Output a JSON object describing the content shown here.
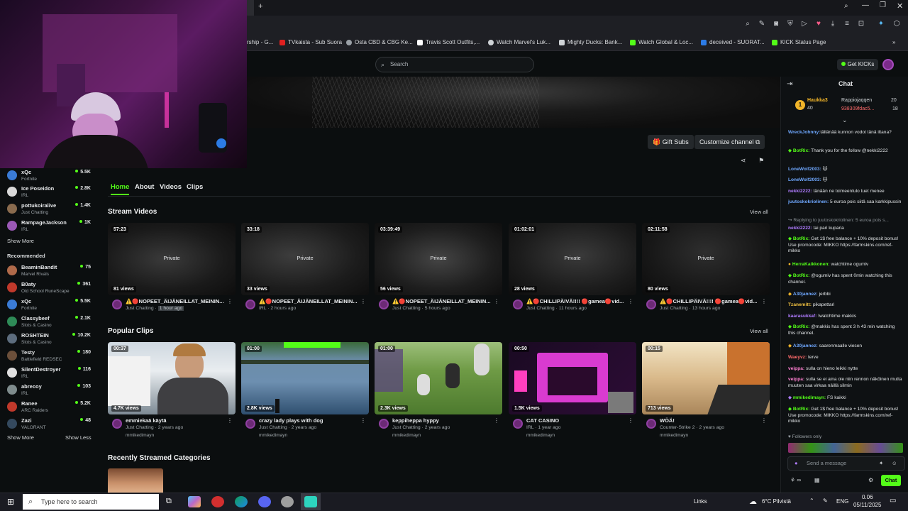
{
  "bookmarks": [
    {
      "label": "rship - G...",
      "color": "#5b8de0"
    },
    {
      "label": "TVkaista - Sub Suora",
      "color": "#e02020"
    },
    {
      "label": "Osta CBD & CBG Ke...",
      "color": "#9aa0a6"
    },
    {
      "label": "Travis Scott Outfits,...",
      "color": "#ffffff"
    },
    {
      "label": "Watch Marvel's Luk...",
      "color": "#cfd3d6"
    },
    {
      "label": "Mighty Ducks: Bank...",
      "color": "#cfd3d6"
    },
    {
      "label": "Watch Global & Loc...",
      "color": "#53fc18"
    },
    {
      "label": "deceived - SUORAT...",
      "color": "#2c7be5"
    },
    {
      "label": "KICK Status Page",
      "color": "#53fc18"
    }
  ],
  "header": {
    "search_placeholder": "Search",
    "get_kicks": "Get KICKs"
  },
  "channel": {
    "gift_subs": "Gift Subs",
    "customize": "Customize channel",
    "tabs": [
      "Home",
      "About",
      "Videos",
      "Clips"
    ]
  },
  "sidebar": {
    "following": [
      {
        "name": "xQc",
        "game": "Fortnite",
        "count": "5.5K",
        "color": "#3a7bd5"
      },
      {
        "name": "Ice Poseidon",
        "game": "IRL",
        "count": "2.8K",
        "color": "#d9d9d9"
      },
      {
        "name": "pottukoiralive",
        "game": "Just Chatting",
        "count": "1.4K",
        "color": "#8a6b4e"
      },
      {
        "name": "RampageJackson",
        "game": "IRL",
        "count": "1K",
        "color": "#9b59b6"
      }
    ],
    "show_more": "Show More",
    "recommended_title": "Recommended",
    "recommended": [
      {
        "name": "BeaminBandit",
        "game": "Marvel Rivals",
        "count": "75",
        "color": "#b06a4a"
      },
      {
        "name": "B0aty",
        "game": "Old School RuneScape",
        "count": "361",
        "color": "#c0392b"
      },
      {
        "name": "xQc",
        "game": "Fortnite",
        "count": "5.5K",
        "color": "#3a7bd5"
      },
      {
        "name": "Classybeef",
        "game": "Slots & Casino",
        "count": "2.1K",
        "color": "#2e8b57"
      },
      {
        "name": "ROSHTEIN",
        "game": "Slots & Casino",
        "count": "10.2K",
        "color": "#5d6d7e"
      },
      {
        "name": "Testy",
        "game": "Battlefield REDSEC",
        "count": "180",
        "color": "#6b4f3a"
      },
      {
        "name": "SilentDestroyer",
        "game": "IRL",
        "count": "116",
        "color": "#e0e0e0"
      },
      {
        "name": "abrecoy",
        "game": "IRL",
        "count": "103",
        "color": "#7f8c8d"
      },
      {
        "name": "Ranee",
        "game": "ARC Raiders",
        "count": "5.2K",
        "color": "#c0392b"
      },
      {
        "name": "Zazi",
        "game": "VALORANT",
        "count": "48",
        "color": "#34495e"
      }
    ],
    "show_more_2": "Show More",
    "show_less": "Show Less"
  },
  "stream_videos": {
    "title": "Stream Videos",
    "view_all": "View all",
    "items": [
      {
        "duration": "57:23",
        "views": "81 views",
        "title": "⚠️🔴NOPEET_ÄIJÄNEILLAT_MEININ...",
        "meta": "Just Chatting",
        "meta_time": "1 hour ago",
        "private": "Private"
      },
      {
        "duration": "33:18",
        "views": "33 views",
        "title": "⚠️🔴NOPEET_ÄIJÄNEILLAT_MEININ...",
        "meta": "IRL · 2 hours ago",
        "meta_time": "",
        "private": "Private"
      },
      {
        "duration": "03:39:49",
        "views": "56 views",
        "title": "⚠️🔴NOPEET_ÄIJÄNEILLAT_MEININ...",
        "meta": "Just Chatting · 5 hours ago",
        "meta_time": "",
        "private": "Private"
      },
      {
        "duration": "01:02:01",
        "views": "28 views",
        "title": "⚠️🔴CHILLIPÄIVÄ!!!! 🔴gamea🔴vid...",
        "meta": "Just Chatting · 11 hours ago",
        "meta_time": "",
        "private": "Private"
      },
      {
        "duration": "02:11:58",
        "views": "80 views",
        "title": "⚠️🔴CHILLIPÄIVÄ!!!! 🔴gamea🔴vid...",
        "meta": "Just Chatting · 13 hours ago",
        "meta_time": "",
        "private": "Private"
      }
    ]
  },
  "popular_clips": {
    "title": "Popular Clips",
    "view_all": "View all",
    "items": [
      {
        "duration": "00:37",
        "views": "4.7K views",
        "title": "emmiekaä käytä",
        "meta": "Just Chatting · 2 years ago",
        "user": "mmikedimayn"
      },
      {
        "duration": "01:00",
        "views": "2.8K views",
        "title": "crazy lady plays with dog",
        "meta": "Just Chatting · 2 years ago",
        "user": "mmikedimayn"
      },
      {
        "duration": "01:00",
        "views": "2.3K views",
        "title": "keppiheppa hyppy",
        "meta": "Just Chatting · 2 years ago",
        "user": "mmikedimayn"
      },
      {
        "duration": "00:50",
        "views": "1.5K views",
        "title": "CAT CASINO",
        "meta": "IRL · 1 year ago",
        "user": "mmikedimayn"
      },
      {
        "duration": "00:15",
        "views": "713 views",
        "title": "WÖÄ!",
        "meta": "Counter-Strike 2 · 2 years ago",
        "user": "mmikedimayn"
      }
    ]
  },
  "recent_categories": {
    "title": "Recently Streamed Categories"
  },
  "chat": {
    "title": "Chat",
    "leaders": [
      {
        "name": "Haukka3",
        "value": "40"
      },
      {
        "name": "Rappiojaqqen",
        "value": "20"
      },
      {
        "name": "938309fdac5...",
        "value": "18"
      }
    ],
    "messages": [
      {
        "user": "WreckJohnny:",
        "text": "tällänää kunnon vodot tänä iltana?",
        "color": "#6fa8ff"
      },
      {
        "user": "BotRix:",
        "text": "Thank you for the follow @nekki2222",
        "color": "#53fc18"
      },
      {
        "user": "LoneWolf2003:",
        "text": "🐱",
        "color": "#6fa8ff"
      },
      {
        "user": "LoneWolf2003:",
        "text": "🐱",
        "color": "#6fa8ff"
      },
      {
        "user": "nekki2222:",
        "text": "tänään ne toimeentulo tuet menee",
        "color": "#b07cff"
      },
      {
        "user": "juutoskokriolinen:",
        "text": "5 euroa pois siitä saa karkkipussin",
        "color": "#6fa8ff"
      },
      {
        "user": "",
        "text": "Replying to juutoskokriolinen: 5 euroa pois s...",
        "color": "#8a9196"
      },
      {
        "user": "nekki2222:",
        "text": "tai pari kuparia",
        "color": "#b07cff"
      },
      {
        "user": "BotRix:",
        "text": "Get 1$ free balance + 10% deposit bonus! Use promocode: MIKKO https://farmskins.com/ref-mikko",
        "color": "#53fc18"
      },
      {
        "user": "HerraKaikkonen:",
        "text": "watchtime ogumiv",
        "color": "#53fc18"
      },
      {
        "user": "BotRix:",
        "text": "@ogumiv has spent 0min watching this channel.",
        "color": "#53fc18"
      },
      {
        "user": "A30jannez:",
        "text": "jerbbi",
        "color": "#6fa8ff"
      },
      {
        "user": "Tzanemitt:",
        "text": "pikapettari",
        "color": "#f0c040"
      },
      {
        "user": "kaarasukkaf:",
        "text": "!watchtime makkis",
        "color": "#b07cff"
      },
      {
        "user": "BotRix:",
        "text": "@makkis has spent 3 h 43 min watching this channel.",
        "color": "#53fc18"
      },
      {
        "user": "A30jannez:",
        "text": "saarenmaalle viesen",
        "color": "#6fa8ff"
      },
      {
        "user": "Waeyvz:",
        "text": "terve",
        "color": "#ff6b6b"
      },
      {
        "user": "veippa:",
        "text": "sulla on hieno leikki nytte",
        "color": "#ff7fd1"
      },
      {
        "user": "veippa:",
        "text": "sulla se ei aina ole niin rennon näköinen mutta muuten saa virkaa näillä silmin",
        "color": "#ff7fd1"
      },
      {
        "user": "mmikedimayn:",
        "text": "FS kaikki",
        "color": "#53fc18"
      },
      {
        "user": "BotRix:",
        "text": "Get 1$ free balance + 10% deposit bonus! Use promocode: MIKKO https://farmskins.com/ref-mikko",
        "color": "#53fc18"
      }
    ],
    "followers_only": "Followers only",
    "send_placeholder": "Send a message",
    "chat_button": "Chat"
  },
  "taskbar": {
    "search_placeholder": "Type here to search",
    "links": "Links",
    "weather": "6°C Pilvistä",
    "lang": "ENG",
    "time": "0.06",
    "date": "05/11/2025"
  },
  "colors": {
    "accent": "#53fc18",
    "background": "#0b0e0f",
    "chat_bg": "#0e1113"
  }
}
